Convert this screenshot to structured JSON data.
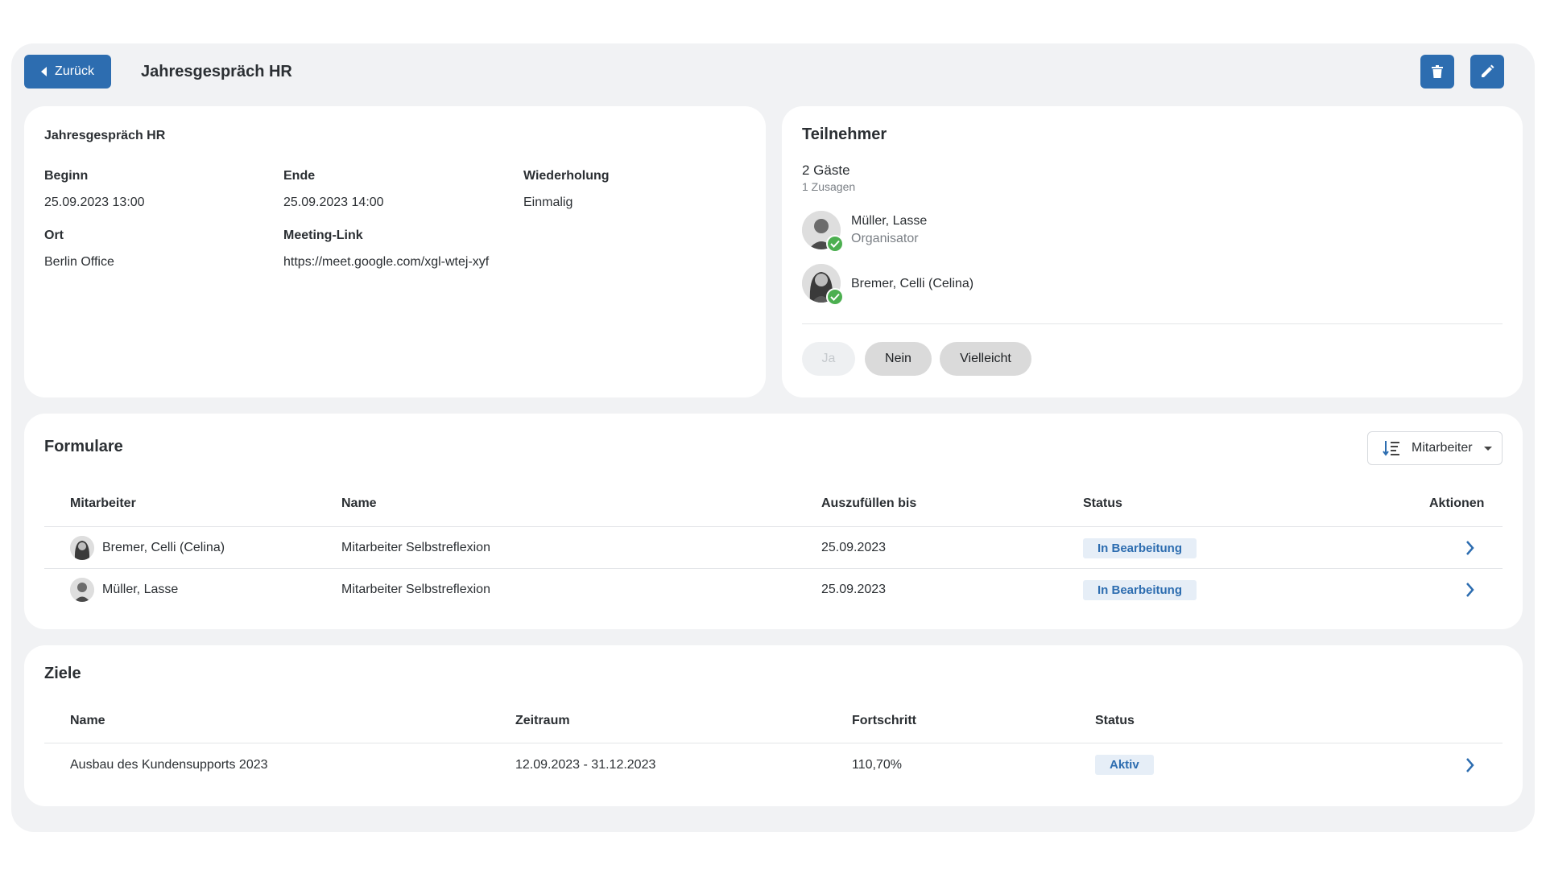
{
  "header": {
    "back_label": "Zurück",
    "title": "Jahresgespräch HR",
    "delete_icon": "trash-icon",
    "edit_icon": "pencil-icon"
  },
  "details": {
    "name": "Jahresgespräch HR",
    "begin_label": "Beginn",
    "begin_value": "25.09.2023 13:00",
    "end_label": "Ende",
    "end_value": "25.09.2023 14:00",
    "repeat_label": "Wiederholung",
    "repeat_value": "Einmalig",
    "location_label": "Ort",
    "location_value": "Berlin Office",
    "link_label": "Meeting-Link",
    "link_value": "https://meet.google.com/xgl-wtej-xyf"
  },
  "participants": {
    "heading": "Teilnehmer",
    "guests": "2 Gäste",
    "accepted": "1 Zusagen",
    "people": [
      {
        "name": "Müller, Lasse",
        "role": "Organisator"
      },
      {
        "name": "Bremer, Celli (Celina)",
        "role": ""
      }
    ],
    "rsvp": {
      "yes": "Ja",
      "no": "Nein",
      "maybe": "Vielleicht"
    }
  },
  "forms": {
    "heading": "Formulare",
    "sort_label": "Mitarbeiter",
    "columns": [
      "Mitarbeiter",
      "Name",
      "Auszufüllen bis",
      "Status",
      "Aktionen"
    ],
    "rows": [
      {
        "employee": "Bremer, Celli (Celina)",
        "name": "Mitarbeiter Selbstreflexion",
        "due": "25.09.2023",
        "status": "In Bearbeitung"
      },
      {
        "employee": "Müller, Lasse",
        "name": "Mitarbeiter Selbstreflexion",
        "due": "25.09.2023",
        "status": "In Bearbeitung"
      }
    ]
  },
  "goals": {
    "heading": "Ziele",
    "columns": [
      "Name",
      "Zeitraum",
      "Fortschritt",
      "Status"
    ],
    "rows": [
      {
        "name": "Ausbau des Kundensupports 2023",
        "period": "12.09.2023 - 31.12.2023",
        "progress": "110,70%",
        "status": "Aktiv"
      }
    ]
  },
  "colors": {
    "primary": "#2d6db0",
    "success": "#4caf50",
    "badge_bg": "#e6eef7"
  }
}
